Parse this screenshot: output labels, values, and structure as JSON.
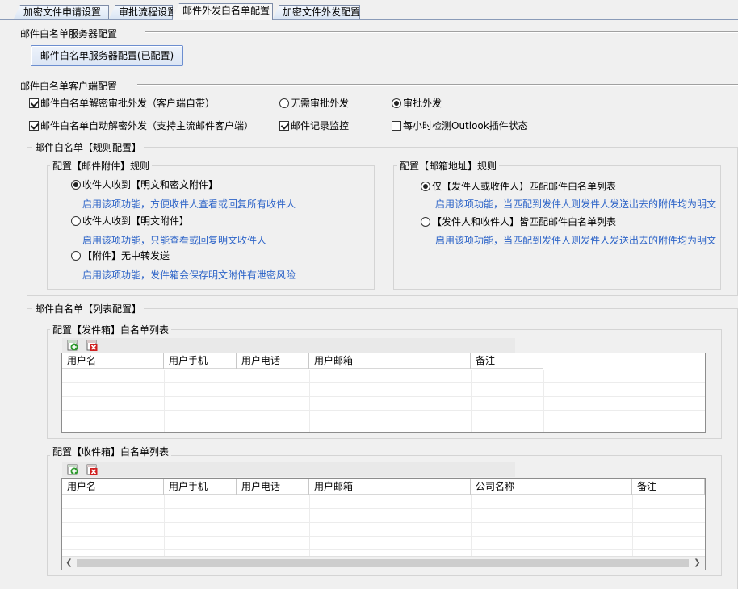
{
  "tabs": [
    {
      "label": "加密文件申请设置"
    },
    {
      "label": "审批流程设置"
    },
    {
      "label": "邮件外发白名单配置"
    },
    {
      "label": "加密文件外发配置"
    }
  ],
  "server_section": {
    "title": "邮件白名单服务器配置",
    "button_label": "邮件白名单服务器配置(已配置)"
  },
  "client_section": {
    "title": "邮件白名单客户端配置",
    "options": [
      {
        "label": "邮件白名单解密审批外发（客户端自带）",
        "checked": true
      },
      {
        "label": "无需审批外发",
        "checked": false
      },
      {
        "label": "审批外发",
        "checked": true
      },
      {
        "label": "邮件白名单自动解密外发（支持主流邮件客户端）",
        "checked": true
      },
      {
        "label": "邮件记录监控",
        "checked": true
      },
      {
        "label": "每小时检测Outlook插件状态",
        "checked": false
      }
    ]
  },
  "rules_section": {
    "title": "邮件白名单【规则配置】",
    "attachment_group": {
      "title": "配置【邮件附件】规则",
      "options": [
        {
          "label": "收件人收到【明文和密文附件】",
          "hint": "启用该项功能，方便收件人查看或回复所有收件人",
          "checked": true
        },
        {
          "label": "收件人收到【明文附件】",
          "hint": "启用该项功能，只能查看或回复明文收件人",
          "checked": false
        },
        {
          "label": "【附件】无中转发送",
          "hint": "启用该项功能，发件箱会保存明文附件有泄密风险",
          "checked": false
        }
      ]
    },
    "address_group": {
      "title": "配置【邮箱地址】规则",
      "options": [
        {
          "label": "仅【发件人或收件人】匹配邮件白名单列表",
          "hint": "启用该项功能，当匹配到发件人则发件人发送出去的附件均为明文",
          "checked": true
        },
        {
          "label": "【发件人和收件人】皆匹配邮件白名单列表",
          "hint": "启用该项功能，当匹配到发件人则发件人发送出去的附件均为明文",
          "checked": false
        }
      ]
    }
  },
  "list_section": {
    "title": "邮件白名单【列表配置】",
    "outbox": {
      "title": "配置【发件箱】白名单列表",
      "columns": [
        "用户名",
        "用户手机",
        "用户电话",
        "用户邮箱",
        "备注"
      ],
      "add_icon": "add-icon",
      "delete_icon": "delete-icon"
    },
    "inbox": {
      "title": "配置【收件箱】白名单列表",
      "columns": [
        "用户名",
        "用户手机",
        "用户电话",
        "用户邮箱",
        "公司名称",
        "备注"
      ],
      "add_icon": "add-icon",
      "delete_icon": "delete-icon"
    }
  },
  "colors": {
    "hint_text": "#2d64c8",
    "tab_border": "#7d8ca8"
  }
}
